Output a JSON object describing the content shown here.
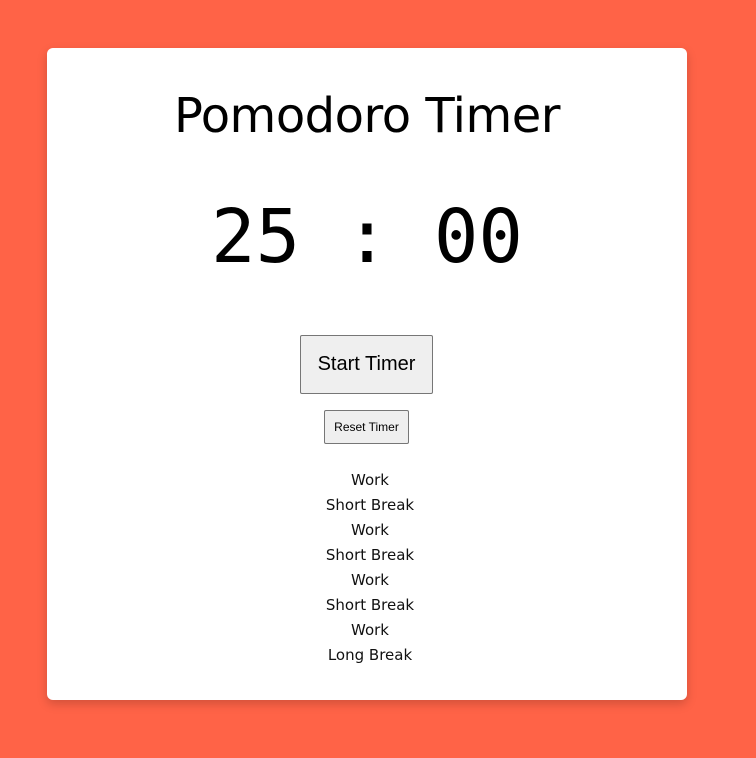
{
  "app": {
    "title": "Pomodoro Timer"
  },
  "timer": {
    "minutes": "25",
    "separator": ":",
    "seconds": "00"
  },
  "controls": {
    "start_label": "Start Timer",
    "reset_label": "Reset Timer"
  },
  "schedule": {
    "items": [
      "Work",
      "Short Break",
      "Work",
      "Short Break",
      "Work",
      "Short Break",
      "Work",
      "Long Break"
    ]
  },
  "colors": {
    "background": "#ff6347",
    "card": "#ffffff",
    "button_face": "#efefef"
  }
}
